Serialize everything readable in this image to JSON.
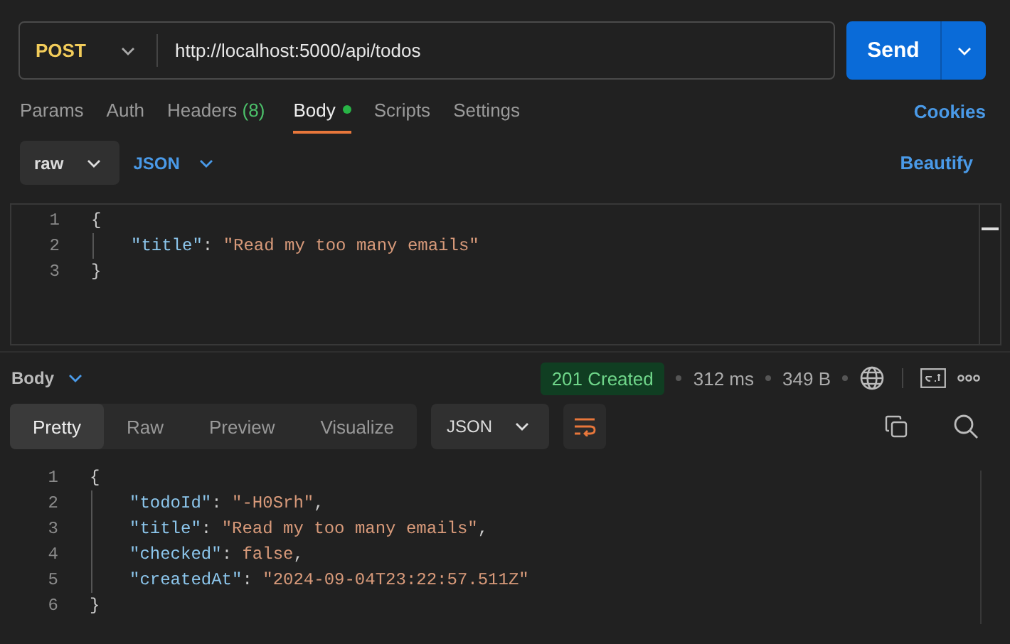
{
  "request": {
    "method": "POST",
    "url": "http://localhost:5000/api/todos",
    "send_label": "Send"
  },
  "tabs": [
    {
      "label": "Params",
      "selected": false
    },
    {
      "label": "Auth",
      "selected": false
    },
    {
      "label": "Headers",
      "count": "(8)",
      "selected": false
    },
    {
      "label": "Body",
      "selected": true,
      "dot": true
    },
    {
      "label": "Scripts",
      "selected": false
    },
    {
      "label": "Settings",
      "selected": false
    }
  ],
  "cookies_link": "Cookies",
  "body_options": {
    "mode": "raw",
    "language": "JSON",
    "beautify": "Beautify"
  },
  "request_body": [
    {
      "number": "1",
      "guide": false,
      "tokens": [
        {
          "kind": "punct",
          "text": "{"
        }
      ]
    },
    {
      "number": "2",
      "guide": true,
      "tokens": [
        {
          "kind": "key",
          "text": "\"title\""
        },
        {
          "kind": "punct",
          "text": ": "
        },
        {
          "kind": "string",
          "text": "\"Read my too many emails\""
        }
      ]
    },
    {
      "number": "3",
      "guide": false,
      "tokens": [
        {
          "kind": "punct",
          "text": "}"
        }
      ]
    }
  ],
  "response": {
    "section": "Body",
    "status": "201 Created",
    "time": "312 ms",
    "size": "349 B",
    "view_tabs": [
      {
        "label": "Pretty",
        "selected": true
      },
      {
        "label": "Raw",
        "selected": false
      },
      {
        "label": "Preview",
        "selected": false
      },
      {
        "label": "Visualize",
        "selected": false
      }
    ],
    "format": "JSON",
    "wrap_on": true,
    "lines": [
      {
        "number": "1",
        "guide": false,
        "tokens": [
          {
            "kind": "punct",
            "text": "{"
          }
        ]
      },
      {
        "number": "2",
        "guide": true,
        "tokens": [
          {
            "kind": "key",
            "text": "\"todoId\""
          },
          {
            "kind": "punct",
            "text": ": "
          },
          {
            "kind": "string",
            "text": "\"-H0Srh\""
          },
          {
            "kind": "punct",
            "text": ","
          }
        ]
      },
      {
        "number": "3",
        "guide": true,
        "tokens": [
          {
            "kind": "key",
            "text": "\"title\""
          },
          {
            "kind": "punct",
            "text": ": "
          },
          {
            "kind": "string",
            "text": "\"Read my too many emails\""
          },
          {
            "kind": "punct",
            "text": ","
          }
        ]
      },
      {
        "number": "4",
        "guide": true,
        "tokens": [
          {
            "kind": "key",
            "text": "\"checked\""
          },
          {
            "kind": "punct",
            "text": ": "
          },
          {
            "kind": "literal",
            "text": "false"
          },
          {
            "kind": "punct",
            "text": ","
          }
        ]
      },
      {
        "number": "5",
        "guide": true,
        "tokens": [
          {
            "kind": "key",
            "text": "\"createdAt\""
          },
          {
            "kind": "punct",
            "text": ": "
          },
          {
            "kind": "string",
            "text": "\"2024-09-04T23:22:57.511Z\""
          }
        ]
      },
      {
        "number": "6",
        "guide": false,
        "tokens": [
          {
            "kind": "punct",
            "text": "}"
          }
        ]
      }
    ]
  }
}
